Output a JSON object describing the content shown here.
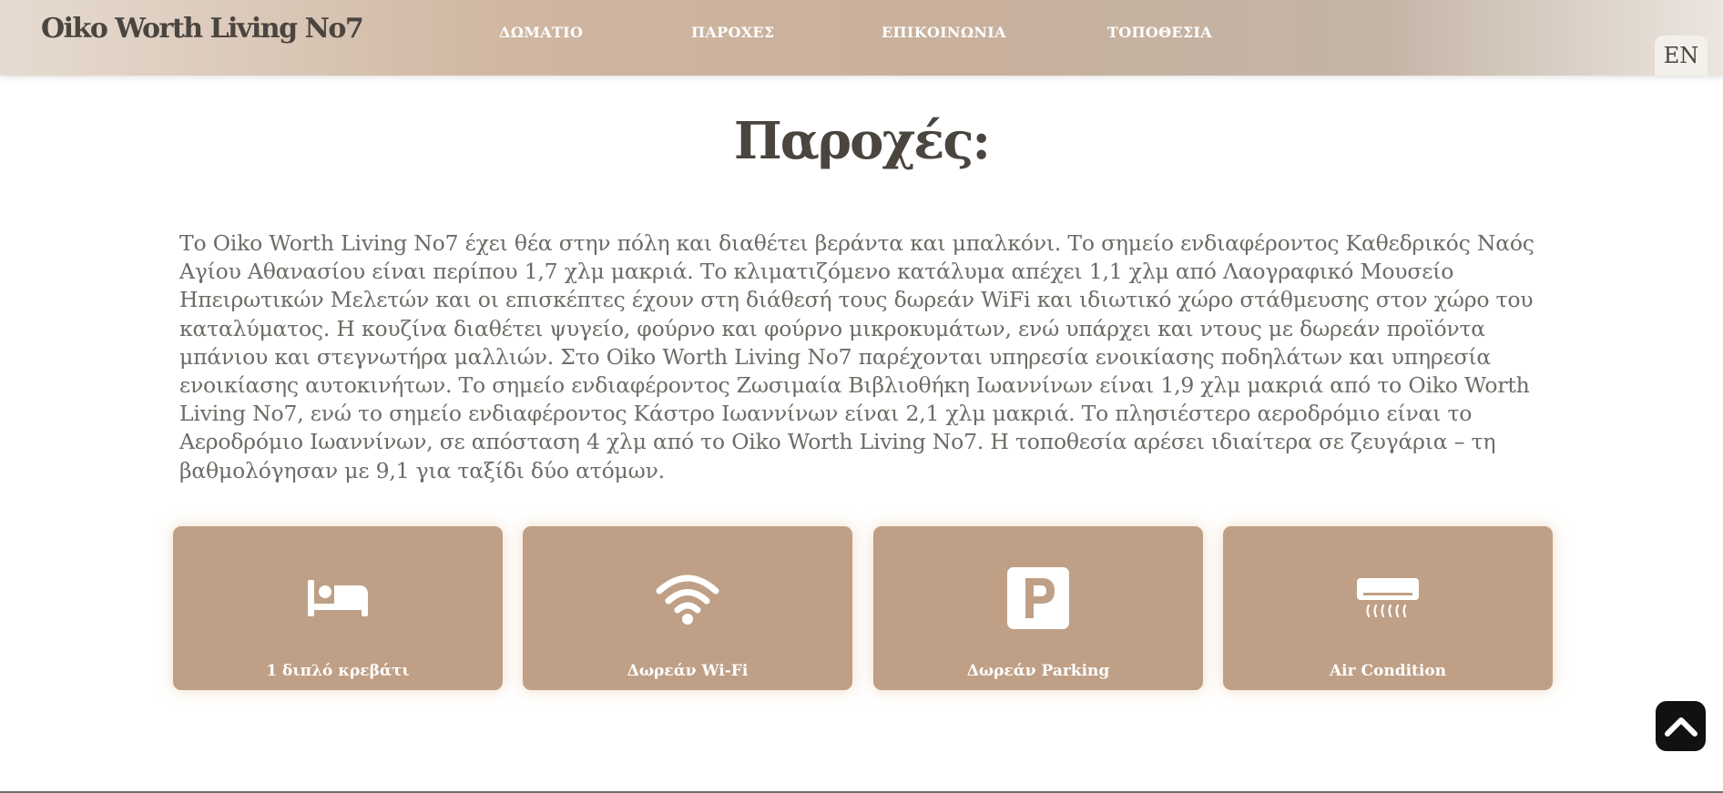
{
  "header": {
    "brand": "Oiko Worth Living No7",
    "nav": [
      "ΔΩΜΑΤΙΟ",
      "ΠΑΡΟΧΕΣ",
      "ΕΠΙΚΟΙΝΩΝΙΑ",
      "ΤΟΠΟΘΕΣΙΑ"
    ],
    "language": "EN"
  },
  "main": {
    "heading": "Παροχές:",
    "description": "Το Oiko Worth Living No7 έχει θέα στην πόλη και διαθέτει βεράντα και μπαλκόνι. Το σημείο ενδιαφέροντος Καθεδρικός Ναός Αγίου Αθανασίου είναι περίπου 1,7 χλμ μακριά. Το κλιματιζόμενο κατάλυμα απέχει 1,1 χλμ από Λαογραφικό Μουσείο Ηπειρωτικών Μελετών και οι επισκέπτες έχουν στη διάθεσή τους δωρεάν WiFi και ιδιωτικό χώρο στάθμευσης στον χώρο του καταλύματος. Η κουζίνα διαθέτει ψυγείο, φούρνο και φούρνο μικροκυμάτων, ενώ υπάρχει και ντους με δωρεάν προϊόντα μπάνιου και στεγνωτήρα μαλλιών. Στο Oiko Worth Living No7 παρέχονται υπηρεσία ενοικίασης ποδηλάτων και υπηρεσία ενοικίασης αυτοκινήτων. Το σημείο ενδιαφέροντος Ζωσιμαία Βιβλιοθήκη Ιωαννίνων είναι 1,9 χλμ μακριά από το Oiko Worth Living No7, ενώ το σημείο ενδιαφέροντος Κάστρο Ιωαννίνων είναι 2,1 χλμ μακριά. Το πλησιέστερο αεροδρόμιο είναι το Αεροδρόμιο Ιωαννίνων, σε απόσταση 4 χλμ από το Oiko Worth Living No7. Η τοποθεσία αρέσει ιδιαίτερα σε ζευγάρια – τη βαθμολόγησαν με 9,1 για ταξίδι δύο ατόμων."
  },
  "amenities": [
    {
      "label": "1 διπλό κρεβάτι",
      "icon": "bed-icon"
    },
    {
      "label": "Δωρεάν Wi-Fi",
      "icon": "wifi-icon"
    },
    {
      "label": "Δωρεάν Parking",
      "icon": "parking-icon"
    },
    {
      "label": "Air Condition",
      "icon": "air-conditioner-icon"
    }
  ],
  "scroll_top": {
    "icon": "chevron-up-icon"
  },
  "colors": {
    "card": "#bfa086",
    "text": "#4a453f",
    "body_text": "#6e6b66"
  }
}
